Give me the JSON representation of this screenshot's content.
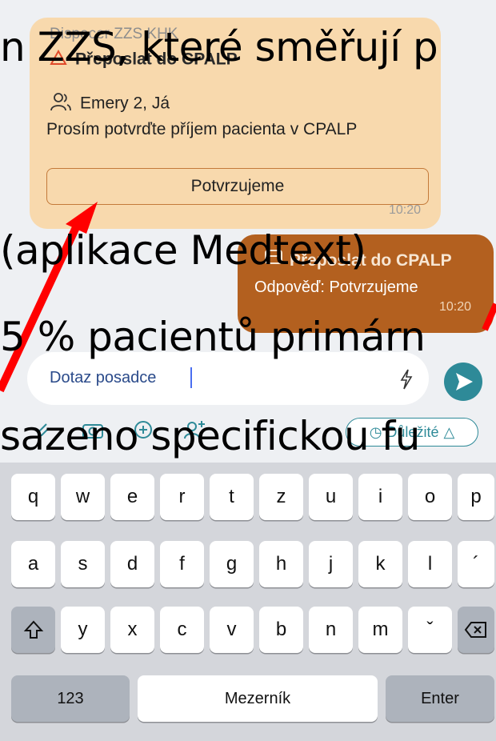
{
  "conversation": {
    "incoming": {
      "sender": "Dispecer ZZS KHK",
      "title": "Přeposlat do CPALP",
      "recipients": "Emery 2, Já",
      "text": "Prosím potvrďte příjem pacienta v CPALP",
      "button_label": "Potvrzujeme",
      "time": "10:20",
      "color": "#f8d9ad"
    },
    "outgoing": {
      "title": "Přeposlat do CPALP",
      "reply": "Odpověď: Potvrzujeme",
      "time": "10:20",
      "color": "#b3601f"
    }
  },
  "composer": {
    "input_value": "Dotaz posadce",
    "important_label": "Důležité",
    "accent": "#2e8a98"
  },
  "keyboard": {
    "row1": [
      "q",
      "w",
      "e",
      "r",
      "t",
      "z",
      "u",
      "i",
      "o",
      "p"
    ],
    "row2": [
      "a",
      "s",
      "d",
      "f",
      "g",
      "h",
      "j",
      "k",
      "l",
      "´"
    ],
    "row3": [
      "y",
      "x",
      "c",
      "v",
      "b",
      "n",
      "m",
      "ˇ"
    ],
    "numbers_label": "123",
    "space_label": "Mezerník",
    "enter_label": "Enter"
  },
  "overlay_text": {
    "line1": "n ZZS, které směřují p",
    "line2": "(aplikace Medtext)",
    "line3": "5 % pacientů primárn",
    "line4": "sazeno specifickou fu"
  }
}
